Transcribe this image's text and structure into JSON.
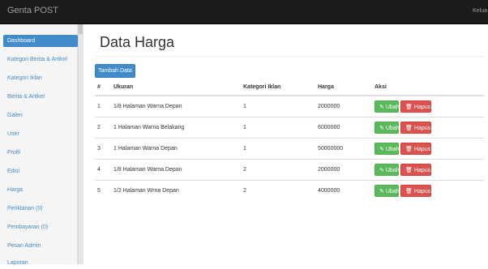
{
  "app": {
    "brand": "Genta POST",
    "topbar_right": "Kelua"
  },
  "sidebar": {
    "items": [
      {
        "label": "Dashboard",
        "active": true
      },
      {
        "label": "Kategori Berita & Artikel"
      },
      {
        "label": "Kategori Iklan"
      },
      {
        "label": "Berita & Artikel"
      },
      {
        "label": "Galeri"
      },
      {
        "label": "User"
      },
      {
        "label": "Profil"
      },
      {
        "label": "Edisi"
      },
      {
        "label": "Harga"
      },
      {
        "label": "Periklanan (0)"
      },
      {
        "label": "Pembayaran (0)"
      },
      {
        "label": "Pesan Admin"
      },
      {
        "label": "Laporan"
      }
    ]
  },
  "main": {
    "title": "Data Harga",
    "add_button": "Tambah Data",
    "columns": [
      "#",
      "Ukuran",
      "Kategori Iklan",
      "Harga",
      "Aksi"
    ],
    "rows": [
      {
        "no": "1",
        "ukuran": "1/8 Halaman Warna Depan",
        "kategori": "1",
        "harga": "2000000"
      },
      {
        "no": "2",
        "ukuran": "1 Halaman Warna Belakang",
        "kategori": "1",
        "harga": "6000000"
      },
      {
        "no": "3",
        "ukuran": "1 Halaman Warna Depan",
        "kategori": "1",
        "harga": "50000000"
      },
      {
        "no": "4",
        "ukuran": "1/8 Halaman Warna Depan",
        "kategori": "2",
        "harga": "2000000"
      },
      {
        "no": "5",
        "ukuran": "1/2 Halaman Wrna Depan",
        "kategori": "2",
        "harga": "4000000"
      }
    ],
    "edit_label": "Ubah",
    "delete_label": "Hapus"
  },
  "colors": {
    "primary": "#428bca",
    "success": "#5cb85c",
    "danger": "#d9534f",
    "topbar": "#1c1c1c"
  },
  "icons": {
    "edit": "pencil-icon",
    "delete": "trash-icon"
  }
}
